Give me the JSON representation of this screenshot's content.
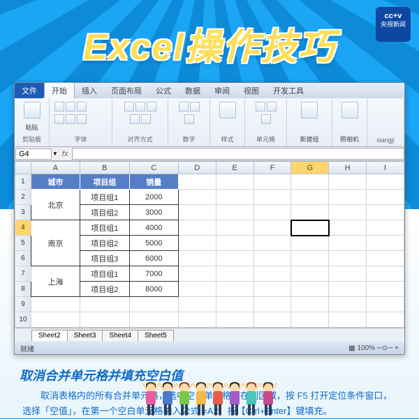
{
  "logo": {
    "line1": "cc+v",
    "line2": "央视新闻"
  },
  "title": "Excel操作技巧",
  "tabs": {
    "file": "文件",
    "home": "开始",
    "insert": "插入",
    "layout": "页面布局",
    "formula": "公式",
    "data": "数据",
    "review": "审阅",
    "view": "视图",
    "dev": "开发工具"
  },
  "ribbon": {
    "paste": "粘贴",
    "clipboard": "剪贴板",
    "font": "字体",
    "align": "对齐方式",
    "number": "数字",
    "style": "样式",
    "cells": "单元格",
    "newgroup": "新建组",
    "insertimg": "照相机",
    "xiangji": "xiangji"
  },
  "namebox": "G4",
  "columns": [
    "",
    "A",
    "B",
    "C",
    "D",
    "E",
    "F",
    "G",
    "H",
    "I"
  ],
  "hdr": {
    "city": "城市",
    "group": "项目组",
    "sales": "销量"
  },
  "rows": [
    {
      "n": "1"
    },
    {
      "n": "2",
      "a": "北京",
      "b": "项目组1",
      "c": "2000",
      "merge": 2
    },
    {
      "n": "3",
      "b": "项目组2",
      "c": "3000"
    },
    {
      "n": "4",
      "a": "南京",
      "b": "项目组1",
      "c": "4000",
      "merge": 3,
      "sel": true
    },
    {
      "n": "5",
      "b": "项目组2",
      "c": "5000"
    },
    {
      "n": "6",
      "b": "项目组3",
      "c": "6000"
    },
    {
      "n": "7",
      "a": "上海",
      "b": "项目组1",
      "c": "7000",
      "merge": 2
    },
    {
      "n": "8",
      "b": "项目组2",
      "c": "8000"
    },
    {
      "n": "9"
    },
    {
      "n": "10"
    }
  ],
  "sheets": [
    "Sheet2",
    "Sheet3",
    "Sheet4",
    "Sheet5"
  ],
  "status": {
    "ready": "就绪",
    "zoom": "100%"
  },
  "subtitle": "取消合并单元格并填充空白值",
  "desc": "取消表格内的所有合并单元格，选中空白单元格所在列区域，按 F5 打开定位条件窗口，选择「空值」，在第一个空白单元格输入公式 =A2，按【Ctrl+Enter】键填充。",
  "people": [
    {
      "hair": "#5a3820",
      "body": "#e85d9e"
    },
    {
      "hair": "#2a2a2a",
      "body": "#4a7bc7"
    },
    {
      "hair": "#8b4a2a",
      "body": "#7bc74a"
    },
    {
      "hair": "#3a3a3a",
      "body": "#f5b942"
    },
    {
      "hair": "#5a3820",
      "body": "#e85d4a"
    },
    {
      "hair": "#2a2a2a",
      "body": "#9e5dc7"
    },
    {
      "hair": "#8b4a2a",
      "body": "#4ac7b9"
    },
    {
      "hair": "#3a3a3a",
      "body": "#c74a8b"
    }
  ]
}
